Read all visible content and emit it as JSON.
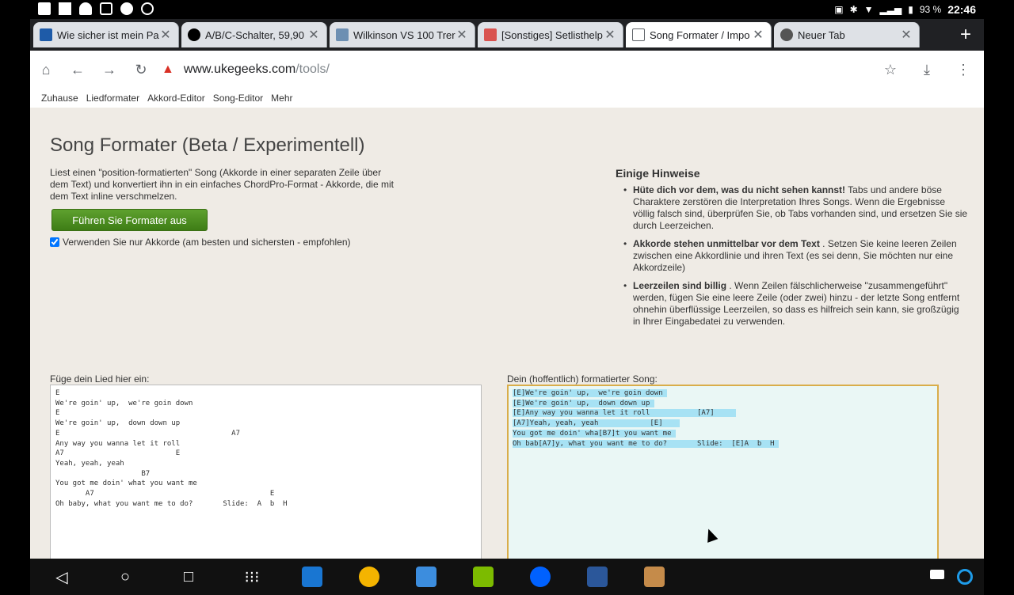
{
  "status": {
    "battery": "93 %",
    "time": "22:46"
  },
  "tabs": [
    {
      "title": "Wie sicher ist mein Pa",
      "favicon": "#1e5ba8"
    },
    {
      "title": "A/B/C-Schalter, 59,90",
      "favicon": "#000"
    },
    {
      "title": "Wilkinson VS 100 Trer",
      "favicon": "#6d8fb2"
    },
    {
      "title": "[Sonstiges] Setlisthelp",
      "favicon": "#d9534f"
    },
    {
      "title": "Song Formater / Impo",
      "favicon": "#fff"
    },
    {
      "title": "Neuer Tab",
      "favicon": "#555"
    }
  ],
  "omnibox": {
    "domain": "www.ukegeeks.com",
    "path": "/tools/"
  },
  "nav": [
    "Zuhause",
    "Liedformater",
    "Akkord-Editor",
    "Song-Editor",
    "Mehr"
  ],
  "page": {
    "title": "Song Formater (Beta / Experimentell)",
    "intro": "Liest einen \"position-formatierten\" Song (Akkorde in einer separaten Zeile über dem Text) und konvertiert ihn in ein einfaches ChordPro-Format - Akkorde, die mit dem Text inline verschmelzen.",
    "run_button": "Führen Sie Formater aus",
    "checkbox_label": "Verwenden Sie nur Akkorde (am besten und sichersten - empfohlen)",
    "tips_title": "Einige Hinweise",
    "tips": [
      {
        "bold": "Hüte dich vor dem, was du nicht sehen kannst!",
        "text": " Tabs und andere böse Charaktere zerstören die Interpretation Ihres Songs. Wenn die Ergebnisse völlig falsch sind, überprüfen Sie, ob Tabs vorhanden sind, und ersetzen Sie sie durch Leerzeichen."
      },
      {
        "bold": "Akkorde stehen unmittelbar vor dem Text",
        "text": " . Setzen Sie keine leeren Zeilen zwischen eine Akkordlinie und ihren Text (es sei denn, Sie möchten nur eine Akkordzeile)"
      },
      {
        "bold": "Leerzeilen sind billig",
        "text": " . Wenn Zeilen fälschlicherweise \"zusammengeführt\" werden, fügen Sie eine leere Zeile (oder zwei) hinzu - der letzte Song entfernt ohnehin überflüssige Leerzeilen, so dass es hilfreich sein kann, sie großzügig in Ihrer Eingabedatei zu verwenden."
      }
    ],
    "input_label": "Füge dein Lied hier ein:",
    "output_label": "Dein (hoffentlich) formatierter Song:",
    "input_text": "E\nWe're goin' up,  we're goin down\nE\nWe're goin' up,  down down up\nE                                        A7\nAny way you wanna let it roll\nA7                          E\nYeah, yeah, yeah\n                    B7\nYou got me doin' what you want me\n       A7                                         E\nOh baby, what you want me to do?       Slide:  A  b  H",
    "output_lines": [
      "[E]We're goin' up,  we're goin down ",
      "[E]We're goin' up,  down down up ",
      "[E]Any way you wanna let it roll           [A7]     ",
      "[A7]Yeah, yeah, yeah            [E]    ",
      "You got me doin' wha[B7]t you want me ",
      "Oh bab[A7]y, what you want me to do?       Slide:  [E]A  b  H "
    ]
  }
}
